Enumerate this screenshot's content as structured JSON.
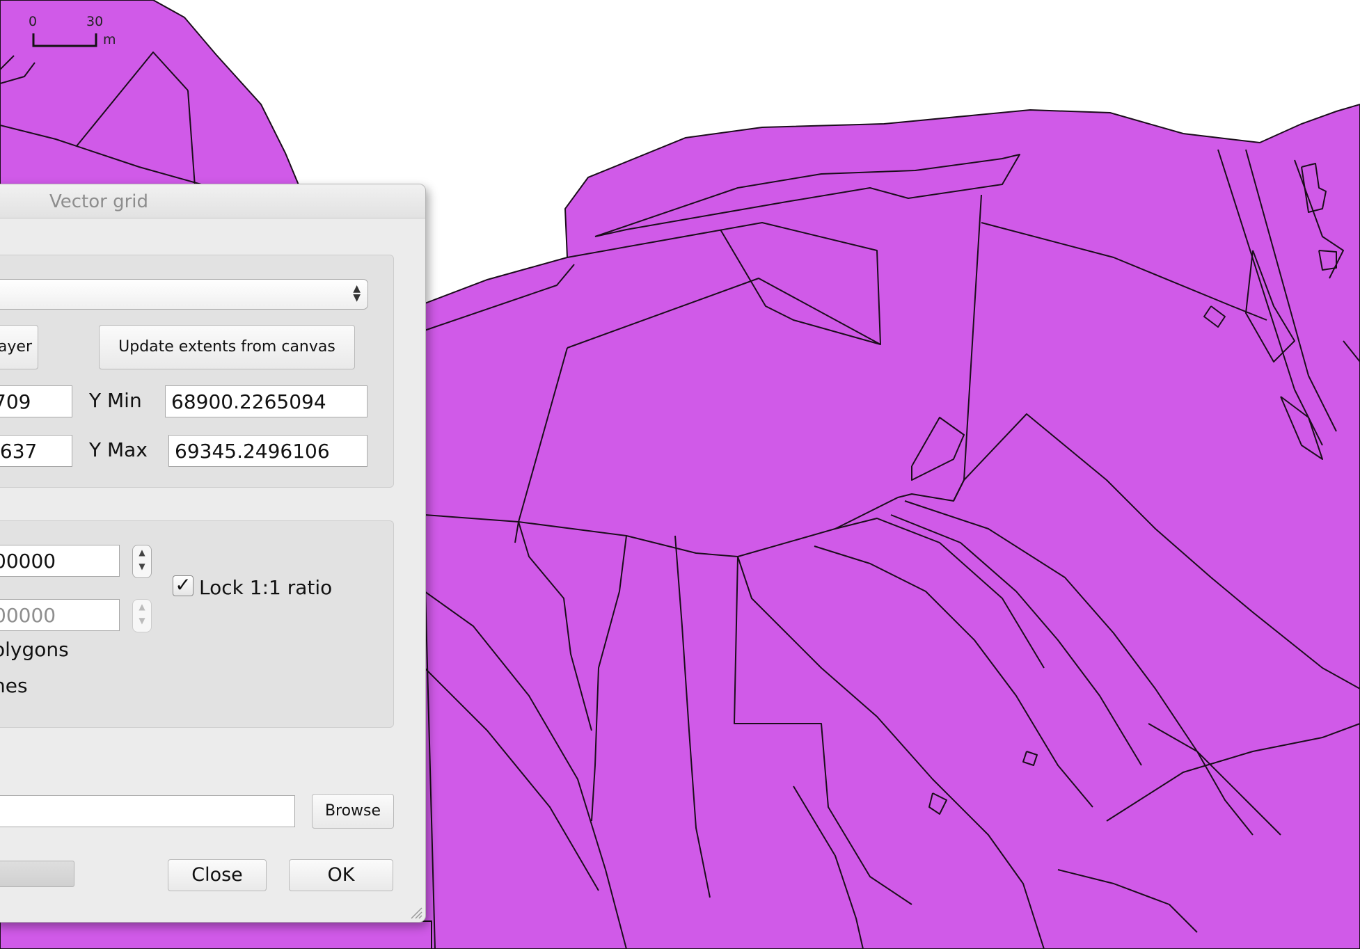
{
  "colors": {
    "parcel_fill": "#d05ae8",
    "parcel_stroke": "#1a0d1a",
    "dialog_bg": "#ececec"
  },
  "map": {
    "scale_bar": {
      "label_start": "0",
      "label_end": "30",
      "unit": "m"
    }
  },
  "dialog": {
    "title": "Vector grid",
    "extent_group": {
      "update_from_layer_label": "ayer",
      "update_from_canvas_label": "Update extents from canvas",
      "x_min_value": "709",
      "x_max_value": ".637",
      "y_min_label": "Y Min",
      "y_min_value": "68900.2265094",
      "y_max_label": "Y Max",
      "y_max_value": "69345.2496106"
    },
    "parameters_group": {
      "x_spacing_value": "00000",
      "y_spacing_value": "00000",
      "lock_ratio_label": "Lock 1:1 ratio",
      "lock_ratio_checked": true,
      "output_polygons_label": "olygons",
      "output_lines_label": "nes"
    },
    "output": {
      "path_value": "",
      "browse_label": "Browse"
    },
    "buttons": {
      "close_label": "Close",
      "ok_label": "OK"
    },
    "progress": 0
  }
}
